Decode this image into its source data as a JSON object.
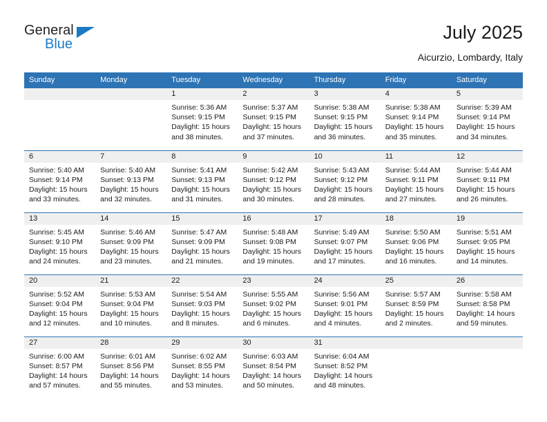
{
  "brand": {
    "name_part1": "General",
    "name_part2": "Blue",
    "accent_color": "#1a7ac4"
  },
  "header": {
    "title": "July 2025",
    "subtitle": "Aicurzio, Lombardy, Italy"
  },
  "theme": {
    "header_blue": "#2e74b5",
    "daynum_band": "#efefef",
    "text": "#1a1a1a"
  },
  "weekday_headers": [
    "Sunday",
    "Monday",
    "Tuesday",
    "Wednesday",
    "Thursday",
    "Friday",
    "Saturday"
  ],
  "weeks": [
    [
      {
        "day": "",
        "sunrise": "",
        "sunset": "",
        "daylight1": "",
        "daylight2": "",
        "empty": true
      },
      {
        "day": "",
        "sunrise": "",
        "sunset": "",
        "daylight1": "",
        "daylight2": "",
        "empty": true
      },
      {
        "day": "1",
        "sunrise": "Sunrise: 5:36 AM",
        "sunset": "Sunset: 9:15 PM",
        "daylight1": "Daylight: 15 hours",
        "daylight2": "and 38 minutes."
      },
      {
        "day": "2",
        "sunrise": "Sunrise: 5:37 AM",
        "sunset": "Sunset: 9:15 PM",
        "daylight1": "Daylight: 15 hours",
        "daylight2": "and 37 minutes."
      },
      {
        "day": "3",
        "sunrise": "Sunrise: 5:38 AM",
        "sunset": "Sunset: 9:15 PM",
        "daylight1": "Daylight: 15 hours",
        "daylight2": "and 36 minutes."
      },
      {
        "day": "4",
        "sunrise": "Sunrise: 5:38 AM",
        "sunset": "Sunset: 9:14 PM",
        "daylight1": "Daylight: 15 hours",
        "daylight2": "and 35 minutes."
      },
      {
        "day": "5",
        "sunrise": "Sunrise: 5:39 AM",
        "sunset": "Sunset: 9:14 PM",
        "daylight1": "Daylight: 15 hours",
        "daylight2": "and 34 minutes."
      }
    ],
    [
      {
        "day": "6",
        "sunrise": "Sunrise: 5:40 AM",
        "sunset": "Sunset: 9:14 PM",
        "daylight1": "Daylight: 15 hours",
        "daylight2": "and 33 minutes."
      },
      {
        "day": "7",
        "sunrise": "Sunrise: 5:40 AM",
        "sunset": "Sunset: 9:13 PM",
        "daylight1": "Daylight: 15 hours",
        "daylight2": "and 32 minutes."
      },
      {
        "day": "8",
        "sunrise": "Sunrise: 5:41 AM",
        "sunset": "Sunset: 9:13 PM",
        "daylight1": "Daylight: 15 hours",
        "daylight2": "and 31 minutes."
      },
      {
        "day": "9",
        "sunrise": "Sunrise: 5:42 AM",
        "sunset": "Sunset: 9:12 PM",
        "daylight1": "Daylight: 15 hours",
        "daylight2": "and 30 minutes."
      },
      {
        "day": "10",
        "sunrise": "Sunrise: 5:43 AM",
        "sunset": "Sunset: 9:12 PM",
        "daylight1": "Daylight: 15 hours",
        "daylight2": "and 28 minutes."
      },
      {
        "day": "11",
        "sunrise": "Sunrise: 5:44 AM",
        "sunset": "Sunset: 9:11 PM",
        "daylight1": "Daylight: 15 hours",
        "daylight2": "and 27 minutes."
      },
      {
        "day": "12",
        "sunrise": "Sunrise: 5:44 AM",
        "sunset": "Sunset: 9:11 PM",
        "daylight1": "Daylight: 15 hours",
        "daylight2": "and 26 minutes."
      }
    ],
    [
      {
        "day": "13",
        "sunrise": "Sunrise: 5:45 AM",
        "sunset": "Sunset: 9:10 PM",
        "daylight1": "Daylight: 15 hours",
        "daylight2": "and 24 minutes."
      },
      {
        "day": "14",
        "sunrise": "Sunrise: 5:46 AM",
        "sunset": "Sunset: 9:09 PM",
        "daylight1": "Daylight: 15 hours",
        "daylight2": "and 23 minutes."
      },
      {
        "day": "15",
        "sunrise": "Sunrise: 5:47 AM",
        "sunset": "Sunset: 9:09 PM",
        "daylight1": "Daylight: 15 hours",
        "daylight2": "and 21 minutes."
      },
      {
        "day": "16",
        "sunrise": "Sunrise: 5:48 AM",
        "sunset": "Sunset: 9:08 PM",
        "daylight1": "Daylight: 15 hours",
        "daylight2": "and 19 minutes."
      },
      {
        "day": "17",
        "sunrise": "Sunrise: 5:49 AM",
        "sunset": "Sunset: 9:07 PM",
        "daylight1": "Daylight: 15 hours",
        "daylight2": "and 17 minutes."
      },
      {
        "day": "18",
        "sunrise": "Sunrise: 5:50 AM",
        "sunset": "Sunset: 9:06 PM",
        "daylight1": "Daylight: 15 hours",
        "daylight2": "and 16 minutes."
      },
      {
        "day": "19",
        "sunrise": "Sunrise: 5:51 AM",
        "sunset": "Sunset: 9:05 PM",
        "daylight1": "Daylight: 15 hours",
        "daylight2": "and 14 minutes."
      }
    ],
    [
      {
        "day": "20",
        "sunrise": "Sunrise: 5:52 AM",
        "sunset": "Sunset: 9:04 PM",
        "daylight1": "Daylight: 15 hours",
        "daylight2": "and 12 minutes."
      },
      {
        "day": "21",
        "sunrise": "Sunrise: 5:53 AM",
        "sunset": "Sunset: 9:04 PM",
        "daylight1": "Daylight: 15 hours",
        "daylight2": "and 10 minutes."
      },
      {
        "day": "22",
        "sunrise": "Sunrise: 5:54 AM",
        "sunset": "Sunset: 9:03 PM",
        "daylight1": "Daylight: 15 hours",
        "daylight2": "and 8 minutes."
      },
      {
        "day": "23",
        "sunrise": "Sunrise: 5:55 AM",
        "sunset": "Sunset: 9:02 PM",
        "daylight1": "Daylight: 15 hours",
        "daylight2": "and 6 minutes."
      },
      {
        "day": "24",
        "sunrise": "Sunrise: 5:56 AM",
        "sunset": "Sunset: 9:01 PM",
        "daylight1": "Daylight: 15 hours",
        "daylight2": "and 4 minutes."
      },
      {
        "day": "25",
        "sunrise": "Sunrise: 5:57 AM",
        "sunset": "Sunset: 8:59 PM",
        "daylight1": "Daylight: 15 hours",
        "daylight2": "and 2 minutes."
      },
      {
        "day": "26",
        "sunrise": "Sunrise: 5:58 AM",
        "sunset": "Sunset: 8:58 PM",
        "daylight1": "Daylight: 14 hours",
        "daylight2": "and 59 minutes."
      }
    ],
    [
      {
        "day": "27",
        "sunrise": "Sunrise: 6:00 AM",
        "sunset": "Sunset: 8:57 PM",
        "daylight1": "Daylight: 14 hours",
        "daylight2": "and 57 minutes."
      },
      {
        "day": "28",
        "sunrise": "Sunrise: 6:01 AM",
        "sunset": "Sunset: 8:56 PM",
        "daylight1": "Daylight: 14 hours",
        "daylight2": "and 55 minutes."
      },
      {
        "day": "29",
        "sunrise": "Sunrise: 6:02 AM",
        "sunset": "Sunset: 8:55 PM",
        "daylight1": "Daylight: 14 hours",
        "daylight2": "and 53 minutes."
      },
      {
        "day": "30",
        "sunrise": "Sunrise: 6:03 AM",
        "sunset": "Sunset: 8:54 PM",
        "daylight1": "Daylight: 14 hours",
        "daylight2": "and 50 minutes."
      },
      {
        "day": "31",
        "sunrise": "Sunrise: 6:04 AM",
        "sunset": "Sunset: 8:52 PM",
        "daylight1": "Daylight: 14 hours",
        "daylight2": "and 48 minutes."
      },
      {
        "day": "",
        "sunrise": "",
        "sunset": "",
        "daylight1": "",
        "daylight2": "",
        "empty": true
      },
      {
        "day": "",
        "sunrise": "",
        "sunset": "",
        "daylight1": "",
        "daylight2": "",
        "empty": true
      }
    ]
  ]
}
